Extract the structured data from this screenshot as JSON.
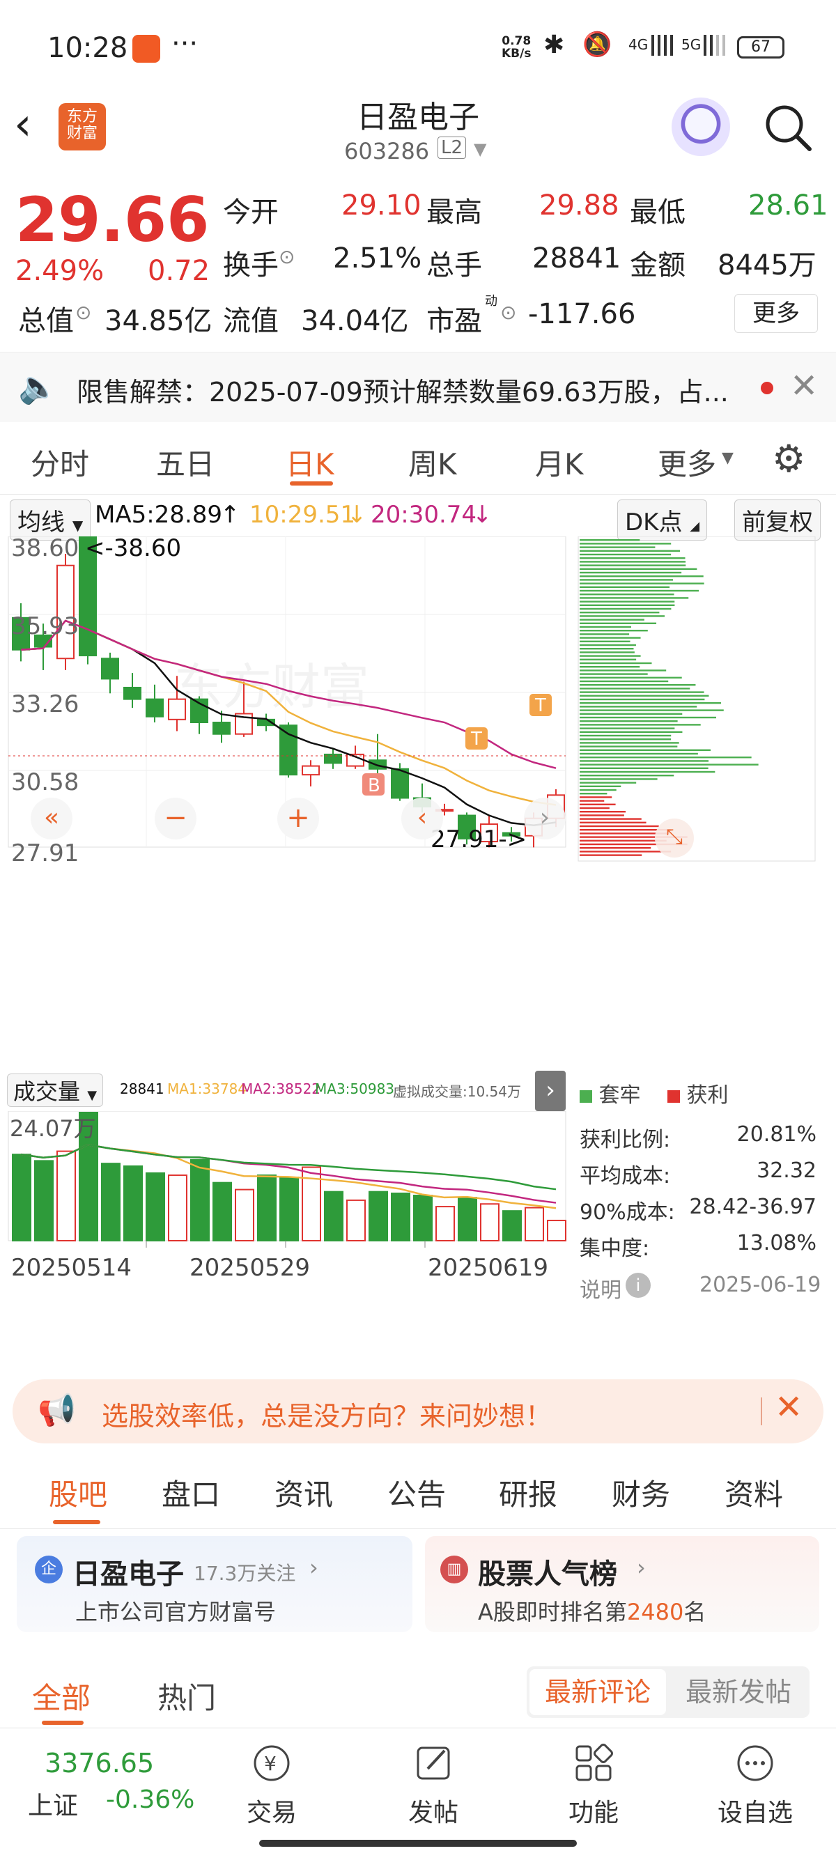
{
  "status_bar": {
    "time": "10:28",
    "dots": "···",
    "speed_top": "0.78",
    "speed_bottom": "KB/s",
    "net1": "4G",
    "net2": "5G",
    "battery": "67"
  },
  "header": {
    "stock_name": "日盈电子",
    "stock_code": "603286",
    "level": "L2"
  },
  "quote": {
    "price": "29.66",
    "change_pct": "2.49%",
    "change": "0.72",
    "open_label": "今开",
    "open": "29.10",
    "high_label": "最高",
    "high": "29.88",
    "low_label": "最低",
    "low": "28.61",
    "turnover_label": "换手",
    "turnover": "2.51%",
    "volume_label": "总手",
    "volume": "28841",
    "amount_label": "金额",
    "amount": "8445万",
    "mktcap_label": "总值",
    "mktcap": "34.85亿",
    "float_label": "流值",
    "float_cap": "34.04亿",
    "pe_label": "市盈",
    "pe_sup": "动",
    "pe": "-117.66",
    "more": "更多"
  },
  "notice": {
    "text": "限售解禁：2025-07-09预计解禁数量69.63万股，占..."
  },
  "ktabs": {
    "items": [
      "分时",
      "五日",
      "日K",
      "周K",
      "月K",
      "更多"
    ],
    "active": 2
  },
  "ma_bar": {
    "selector": "均线",
    "ma5": "MA5:28.89",
    "ma10": "10:29.51",
    "ma20": "20:30.74",
    "dk": "DK点",
    "adj": "前复权"
  },
  "price_axis": {
    "top": "38.60",
    "l2": "35.93",
    "l3": "33.26",
    "l4": "30.58",
    "bottom": "27.91",
    "max_label": "<-38.60",
    "min_label": "27.91->"
  },
  "markers": {
    "b": "B",
    "t": "T"
  },
  "volume_bar": {
    "label": "成交量",
    "v": "28841",
    "ma1": "MA1:33784",
    "ma2": "MA2:38522",
    "ma3": "MA3:50983",
    "virtual": "虚拟成交量:10.54万",
    "max": "24.07万"
  },
  "dates": {
    "d1": "20250514",
    "d2": "20250529",
    "d3": "20250619"
  },
  "chip": {
    "legend_trapped": "套牢",
    "legend_profit": "获利",
    "rows": [
      {
        "label": "获利比例:",
        "value": "20.81%"
      },
      {
        "label": "平均成本:",
        "value": "32.32"
      },
      {
        "label": "90%成本:",
        "value": "28.42-36.97"
      },
      {
        "label": "集中度:",
        "value": "13.08%"
      }
    ],
    "note_label": "说明",
    "note_date": "2025-06-19"
  },
  "chart_data": {
    "type": "candlestick",
    "ylim": [
      27.91,
      38.6
    ],
    "candles": [
      {
        "o": 35.8,
        "c": 34.7,
        "h": 36.3,
        "l": 34.3
      },
      {
        "o": 35.2,
        "c": 34.8,
        "h": 35.6,
        "l": 34.0
      },
      {
        "o": 34.4,
        "c": 37.6,
        "h": 38.0,
        "l": 34.0
      },
      {
        "o": 38.6,
        "c": 34.5,
        "h": 38.6,
        "l": 34.2
      },
      {
        "o": 34.4,
        "c": 33.7,
        "h": 34.6,
        "l": 33.2
      },
      {
        "o": 33.4,
        "c": 33.0,
        "h": 33.9,
        "l": 32.7
      },
      {
        "o": 33.0,
        "c": 32.4,
        "h": 33.5,
        "l": 32.2
      },
      {
        "o": 32.3,
        "c": 33.0,
        "h": 33.8,
        "l": 31.9
      },
      {
        "o": 33.0,
        "c": 32.2,
        "h": 33.1,
        "l": 31.8
      },
      {
        "o": 32.2,
        "c": 31.8,
        "h": 32.6,
        "l": 31.5
      },
      {
        "o": 31.8,
        "c": 32.5,
        "h": 33.6,
        "l": 31.7
      },
      {
        "o": 32.3,
        "c": 32.1,
        "h": 32.5,
        "l": 31.9
      },
      {
        "o": 32.1,
        "c": 30.4,
        "h": 32.2,
        "l": 30.3
      },
      {
        "o": 30.4,
        "c": 30.7,
        "h": 30.9,
        "l": 30.0
      },
      {
        "o": 31.1,
        "c": 30.8,
        "h": 31.3,
        "l": 30.6
      },
      {
        "o": 30.7,
        "c": 31.1,
        "h": 31.4,
        "l": 30.6
      },
      {
        "o": 30.9,
        "c": 30.6,
        "h": 31.8,
        "l": 30.3
      },
      {
        "o": 30.6,
        "c": 29.6,
        "h": 30.8,
        "l": 29.5
      },
      {
        "o": 29.6,
        "c": 29.3,
        "h": 30.1,
        "l": 29.1
      },
      {
        "o": 29.2,
        "c": 29.2,
        "h": 29.4,
        "l": 29.0
      },
      {
        "o": 29.0,
        "c": 28.2,
        "h": 29.1,
        "l": 28.0
      },
      {
        "o": 28.1,
        "c": 28.7,
        "h": 29.0,
        "l": 27.9
      },
      {
        "o": 28.4,
        "c": 28.3,
        "h": 28.6,
        "l": 28.1
      },
      {
        "o": 28.3,
        "c": 28.9,
        "h": 29.1,
        "l": 27.9
      },
      {
        "o": 28.9,
        "c": 29.7,
        "h": 29.9,
        "l": 28.6
      }
    ],
    "volume": [
      16.2,
      15.0,
      16.8,
      24.07,
      14.5,
      14.0,
      12.7,
      12.3,
      15.2,
      10.9,
      9.6,
      12.3,
      11.9,
      13.8,
      9.2,
      7.6,
      9.2,
      8.9,
      8.5,
      6.4,
      8.1,
      6.9,
      5.6,
      6.2,
      3.8
    ]
  },
  "promo": {
    "text": "选股效率低，总是没方向？来问妙想！"
  },
  "btabs": {
    "items": [
      "股吧",
      "盘口",
      "资讯",
      "公告",
      "研报",
      "财务",
      "资料"
    ],
    "active": 0
  },
  "cards": {
    "left_title": "日盈电子",
    "left_follow": "17.3万关注",
    "left_sub": "上市公司官方财富号",
    "right_title": "股票人气榜",
    "right_sub_a": "A股即时排名第",
    "right_rank": "2480",
    "right_sub_b": "名"
  },
  "subtabs": {
    "all": "全部",
    "hot": "热门",
    "latest_comment": "最新评论",
    "latest_post": "最新发帖"
  },
  "bottom_nav": {
    "index_value": "3376.65",
    "index_name": "上证",
    "index_change": "-0.36%",
    "trade": "交易",
    "post": "发帖",
    "func": "功能",
    "watch": "设自选"
  },
  "colors": {
    "up": "#e0332f",
    "down": "#2e9b3a",
    "accent": "#e8632b",
    "ma5": "#111111",
    "ma10": "#f0b23c",
    "ma20": "#c2277f"
  }
}
